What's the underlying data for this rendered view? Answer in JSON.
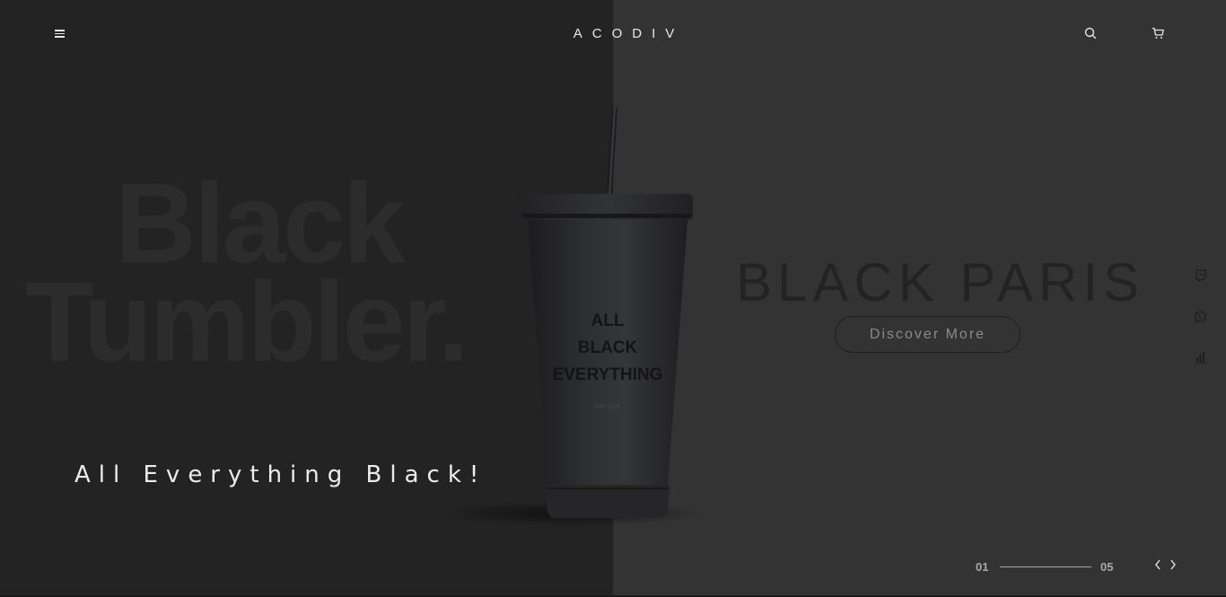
{
  "header": {
    "logo": "ACODIV",
    "menu_icon": "hamburger-menu-icon",
    "search_icon": "search-icon",
    "cart_icon": "shopping-cart-icon"
  },
  "hero": {
    "ghost_line_1": "Black",
    "ghost_line_2": "Tumbler.",
    "tagline": "All Everything Black!",
    "brand_title": "BLACK PARIS",
    "cta_label": "Discover More"
  },
  "product": {
    "print_line_1": "ALL",
    "print_line_2": "BLACK",
    "print_line_3": "EVERYTHING",
    "print_small": "EST. 2018"
  },
  "social": [
    "twitch-icon",
    "whatsapp-icon",
    "bar-chart-icon"
  ],
  "pager": {
    "current": "01",
    "total": "05",
    "progress": 0.2
  },
  "colors": {
    "left_bg": "#232323",
    "right_bg": "#333333",
    "accent_text": "#e8e8e8"
  }
}
